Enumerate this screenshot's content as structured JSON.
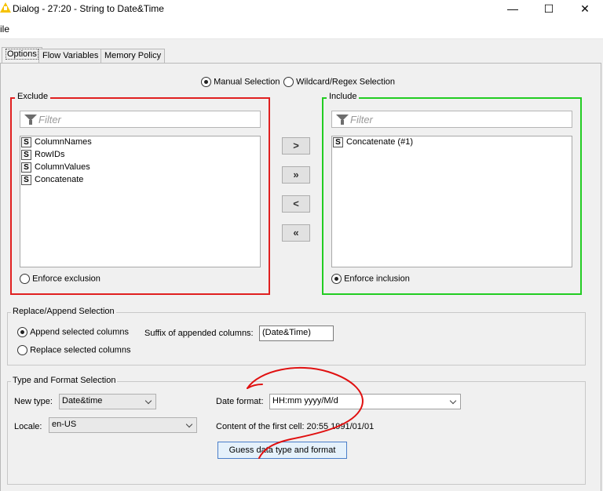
{
  "window": {
    "title": "Dialog - 27:20 - String to Date&Time",
    "minimize_glyph": "—",
    "maximize_glyph": "☐",
    "close_glyph": "✕"
  },
  "menu": {
    "file_label": "ile"
  },
  "tabs": [
    {
      "label": "Options",
      "selected": true
    },
    {
      "label": "Flow Variables",
      "selected": false
    },
    {
      "label": "Memory Policy",
      "selected": false
    }
  ],
  "selection_mode": {
    "manual_label": "Manual Selection",
    "manual_selected": true,
    "wildcard_label": "Wildcard/Regex Selection",
    "wildcard_selected": false
  },
  "exclude": {
    "title": "Exclude",
    "filter_placeholder": "Filter",
    "items": [
      {
        "type_icon": "S",
        "name": "ColumnNames"
      },
      {
        "type_icon": "S",
        "name": "RowIDs"
      },
      {
        "type_icon": "S",
        "name": "ColumnValues"
      },
      {
        "type_icon": "S",
        "name": "Concatenate"
      }
    ],
    "enforce_label": "Enforce exclusion",
    "enforce_selected": false,
    "border_color": "#e02020"
  },
  "include": {
    "title": "Include",
    "filter_placeholder": "Filter",
    "items": [
      {
        "type_icon": "S",
        "name": "Concatenate (#1)"
      }
    ],
    "enforce_label": "Enforce inclusion",
    "enforce_selected": true,
    "border_color": "#22cc22"
  },
  "move_buttons": {
    "add": ">",
    "add_all": "»",
    "remove": "<",
    "remove_all": "«"
  },
  "replace_append": {
    "title": "Replace/Append Selection",
    "append_label": "Append selected columns",
    "append_selected": true,
    "replace_label": "Replace selected columns",
    "replace_selected": false,
    "suffix_label": "Suffix of appended columns:",
    "suffix_value": "(Date&Time)"
  },
  "type_format": {
    "title": "Type and Format Selection",
    "new_type_label": "New type:",
    "new_type_value": "Date&time",
    "locale_label": "Locale:",
    "locale_value": "en-US",
    "date_format_label": "Date format:",
    "date_format_value": "HH:mm yyyy/M/d",
    "first_cell_label": "Content of the first cell: 20:55 1991/01/01",
    "guess_button": "Guess data type and format"
  },
  "annotation": {
    "color": "#e01010"
  }
}
